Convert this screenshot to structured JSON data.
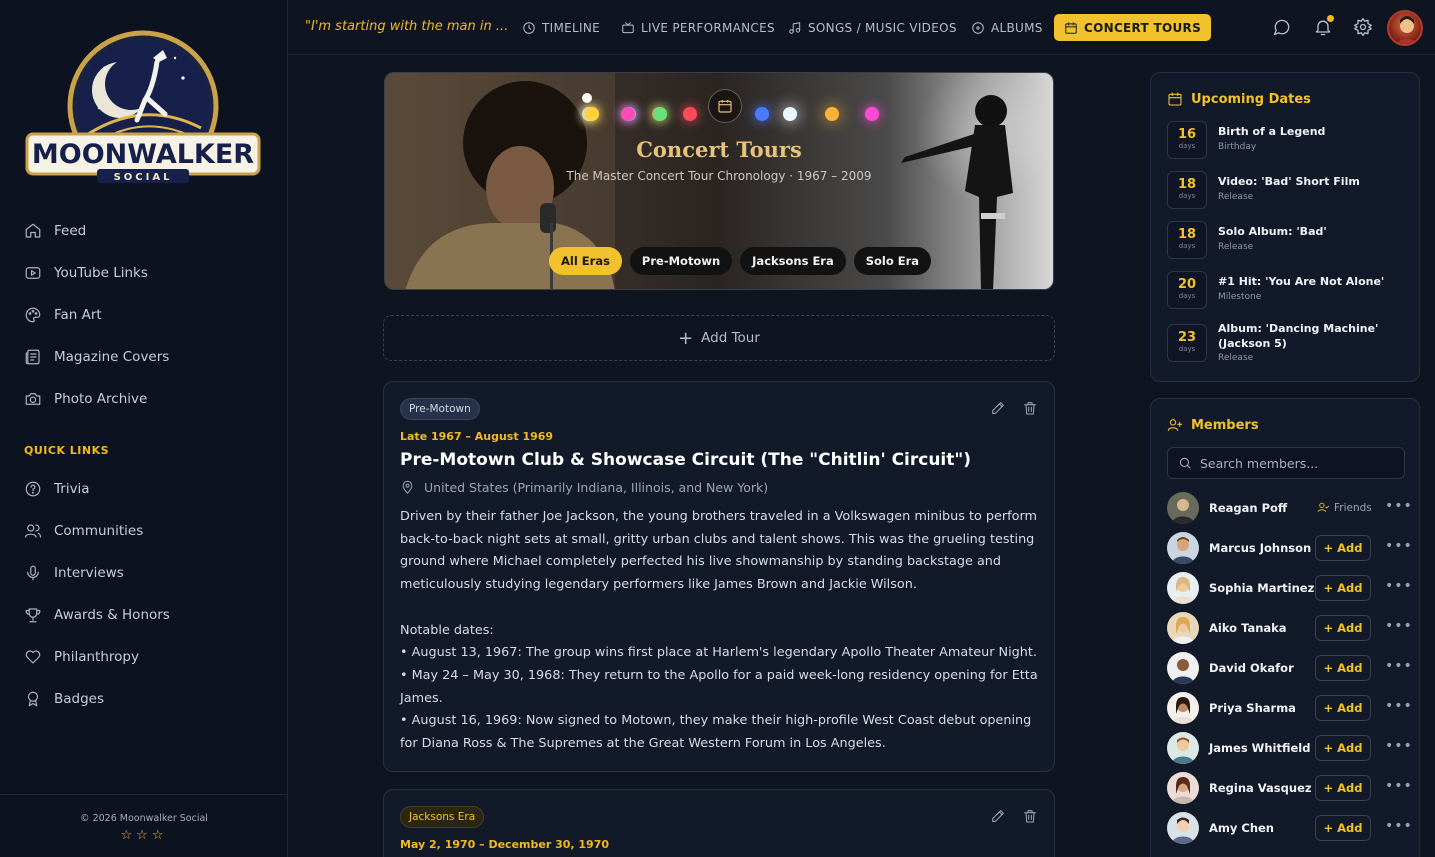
{
  "brand": {
    "name": "MOONWALKER",
    "tagline": "SOCIAL"
  },
  "sidebar": {
    "items": [
      {
        "label": "Feed",
        "icon": "home-icon"
      },
      {
        "label": "YouTube Links",
        "icon": "youtube-icon"
      },
      {
        "label": "Fan Art",
        "icon": "palette-icon"
      },
      {
        "label": "Magazine Covers",
        "icon": "newspaper-icon"
      },
      {
        "label": "Photo Archive",
        "icon": "camera-icon"
      }
    ],
    "quick_links_label": "QUICK LINKS",
    "quick_links": [
      {
        "label": "Trivia",
        "icon": "help-circle-icon"
      },
      {
        "label": "Communities",
        "icon": "users-icon"
      },
      {
        "label": "Interviews",
        "icon": "microphone-icon"
      },
      {
        "label": "Awards & Honors",
        "icon": "trophy-icon"
      },
      {
        "label": "Philanthropy",
        "icon": "heart-icon"
      },
      {
        "label": "Badges",
        "icon": "award-icon"
      }
    ],
    "copyright": "© 2026 Moonwalker Social",
    "stars": "☆☆☆"
  },
  "topbar": {
    "quote": "\"I'm starting with the man in ...",
    "nav": [
      {
        "label": "TIMELINE",
        "icon": "clock-icon"
      },
      {
        "label": "LIVE PERFORMANCES",
        "icon": "tv-icon"
      },
      {
        "label": "SONGS / MUSIC VIDEOS",
        "icon": "music-icon"
      },
      {
        "label": "ALBUMS",
        "icon": "disc-icon"
      },
      {
        "label": "CONCERT TOURS",
        "icon": "calendar-icon",
        "active": true
      }
    ]
  },
  "hero": {
    "title": "Concert Tours",
    "subtitle": "The Master Concert Tour Chronology · 1967 – 2009",
    "filters": [
      "All Eras",
      "Pre-Motown",
      "Jacksons Era",
      "Solo Era"
    ],
    "active_filter": "All Eras"
  },
  "add_tour_label": "Add Tour",
  "tours": [
    {
      "era": "Pre-Motown",
      "dates": "Late 1967 – August 1969",
      "title": "Pre-Motown Club & Showcase Circuit (The \"Chitlin' Circuit\")",
      "location": "United States (Primarily Indiana, Illinois, and New York)",
      "description": "Driven by their father Joe Jackson, the young brothers traveled in a Volkswagen minibus to perform back-to-back night sets at small, gritty urban clubs and talent shows. This was the grueling testing ground where Michael completely perfected his live showmanship by standing backstage and meticulously studying legendary performers like James Brown and Jackie Wilson.",
      "notable_label": "Notable dates:",
      "notable": [
        "• August 13, 1967: The group wins first place at Harlem's legendary Apollo Theater Amateur Night.",
        "• May 24 – May 30, 1968: They return to the Apollo for a paid week-long residency opening for Etta James.",
        "• August 16, 1969: Now signed to Motown, they make their high-profile West Coast debut opening for Diana Ross & The Supremes at the Great Western Forum in Los Angeles."
      ]
    },
    {
      "era": "Jacksons Era",
      "dates": "May 2, 1970 – December 30, 1970"
    }
  ],
  "upcoming": {
    "title": "Upcoming Dates",
    "days_label": "days",
    "events": [
      {
        "days": "16",
        "title": "Birth of a Legend",
        "type": "Birthday"
      },
      {
        "days": "18",
        "title": "Video: 'Bad' Short Film",
        "type": "Release"
      },
      {
        "days": "18",
        "title": "Solo Album: 'Bad'",
        "type": "Release"
      },
      {
        "days": "20",
        "title": "#1 Hit: 'You Are Not Alone'",
        "type": "Milestone"
      },
      {
        "days": "23",
        "title": "Album: 'Dancing Machine' (Jackson 5)",
        "type": "Release"
      }
    ]
  },
  "members": {
    "title": "Members",
    "search_placeholder": "Search members...",
    "add_label": "+ Add",
    "friends_label": "Friends",
    "list": [
      {
        "name": "Reagan Poff",
        "friend": true
      },
      {
        "name": "Marcus Johnson"
      },
      {
        "name": "Sophia Martinez"
      },
      {
        "name": "Aiko Tanaka"
      },
      {
        "name": "David Okafor"
      },
      {
        "name": "Priya Sharma"
      },
      {
        "name": "James Whitfield"
      },
      {
        "name": "Regina Vasquez"
      },
      {
        "name": "Amy Chen"
      }
    ]
  },
  "colors": {
    "accent": "#f2c12e",
    "background": "#0f1421",
    "panel": "#121a2a"
  }
}
